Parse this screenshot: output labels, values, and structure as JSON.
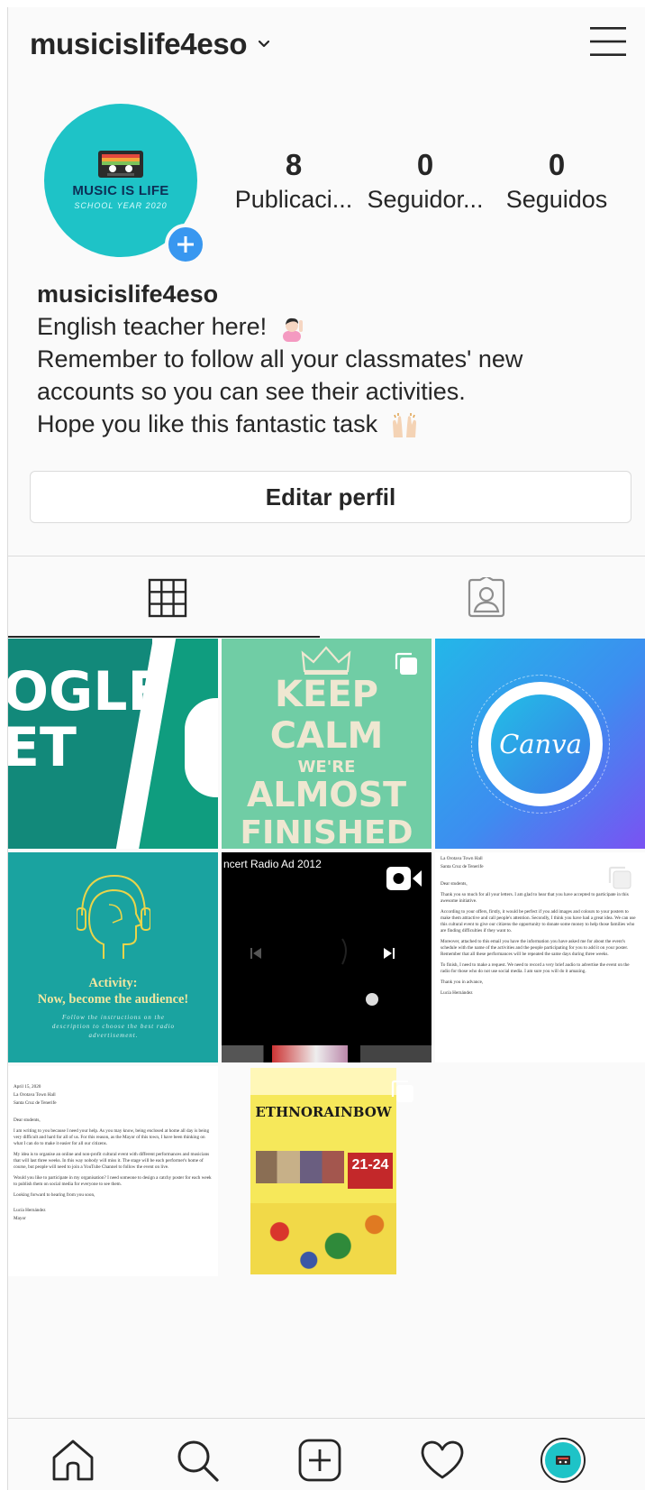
{
  "header": {
    "username": "musicislife4eso"
  },
  "avatar": {
    "title": "MUSIC IS LIFE",
    "subtitle": "SCHOOL YEAR 2020"
  },
  "stats": [
    {
      "num": "8",
      "label": "Publicaci..."
    },
    {
      "num": "0",
      "label": "Seguidor..."
    },
    {
      "num": "0",
      "label": "Seguidos"
    }
  ],
  "bio": {
    "name": "musicislife4eso",
    "lines": [
      "English teacher here!",
      "Remember to follow all your classmates' new",
      "accounts so you can see their activities.",
      "Hope you like this fantastic task"
    ]
  },
  "edit_profile_label": "Editar perfil",
  "posts": {
    "p1": {
      "lines": [
        "OGLE",
        "ET"
      ]
    },
    "p2": {
      "lines": [
        "KEEP",
        "CALM",
        "WE'RE",
        "ALMOST",
        "FINISHED"
      ]
    },
    "p3": {
      "logo": "Canva"
    },
    "p4": {
      "title": "Activity:",
      "subtitle": "Now, become the audience!",
      "note": "Follow the instructions on the description to choose the best radio advertisement."
    },
    "p5": {
      "caption": "ncert Radio Ad 2012"
    },
    "p6": {
      "lines": [
        "La Orotava Town Hall",
        "Santa Cruz de Tenerife",
        "Dear students,",
        "Thank you so much for all your letters. I am glad to hear that you have accepted to participate in this awesome initiative.",
        "According to your offers, firstly, it would be perfect if you add images and colours to your posters to make them attractive and call people's attention. Secondly, I think you have had a great idea. We can use this cultural event to give our citizens the opportunity to donate some money to help those families who are finding difficulties if they want to.",
        "Moreover, attached to this email you have the information you have asked me for about the event's schedule with the name of the activities and the people participating for you to add it on your poster. Remember that all these performances will be repeated the same days during three weeks.",
        "To finish, I need to make a request. We need to record a very brief audio to advertise the event on the radio for those who do not use social media. I am sure you will do it amazing.",
        "Thank you in advance,",
        "Lucía Hernández"
      ]
    },
    "p7": {
      "lines": [
        "April 15, 2020",
        "La Orotava Town Hall",
        "Santa Cruz de Tenerife",
        "Dear students,",
        "I am writing to you because I need your help. As you may know, being enclosed at home all day is being very difficult and hard for all of us. For this reason, as the Mayor of this town, I have been thinking on what I can do to make it easier for all our citizens.",
        "My idea is to organise an online and non-profit cultural event with different performances and musicians that will last three weeks. In this way nobody will miss it. The stage will be each performer's home of course, but people will need to join a YouTube Channel to follow the event on live.",
        "Would you like to participate in my organisation? I need someone to design a catchy poster for each week to publish them on social media for everyone to see them.",
        "Looking forward to hearing from you soon,",
        "Lucía Hernández",
        "Mayor"
      ]
    },
    "p8": {
      "title": "ETHNORAINBOW",
      "dates": "21-24"
    }
  },
  "colors": {
    "accent": "#3897f0",
    "avatar_bg": "#1ec3c7",
    "text": "#262626",
    "border": "#dbdbdb"
  },
  "icons": [
    "chevron-down-icon",
    "hamburger-menu-icon",
    "plus-icon",
    "grid-icon",
    "tagged-icon",
    "multiple-posts-icon",
    "video-icon",
    "home-icon",
    "search-icon",
    "add-post-icon",
    "heart-icon"
  ]
}
